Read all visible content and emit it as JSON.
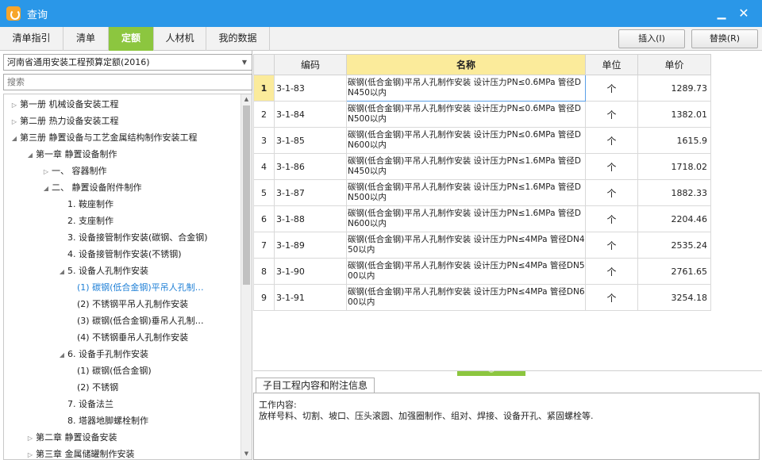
{
  "window": {
    "title": "查询",
    "minimize": "▁",
    "close": "✕"
  },
  "tabs": [
    {
      "label": "清单指引"
    },
    {
      "label": "清单"
    },
    {
      "label": "定额"
    },
    {
      "label": "人材机"
    },
    {
      "label": "我的数据"
    }
  ],
  "toolbar": {
    "insert_label": "插入(I)",
    "replace_label": "替换(R)"
  },
  "left_panel": {
    "quota_library": "河南省通用安装工程预算定额(2016)",
    "search_placeholder": "搜索",
    "tree": [
      {
        "label": "第一册 机械设备安装工程",
        "arrow": "▷"
      },
      {
        "label": "第二册 热力设备安装工程",
        "arrow": "▷"
      },
      {
        "label": "第三册 静置设备与工艺金属结构制作安装工程",
        "arrow": "◢"
      },
      {
        "label": "第一章 静置设备制作",
        "arrow": "◢"
      },
      {
        "label": "一、 容器制作",
        "arrow": "▷"
      },
      {
        "label": "二、 静置设备附件制作",
        "arrow": "◢"
      },
      {
        "label": "1. 鞍座制作",
        "arrow": ""
      },
      {
        "label": "2. 支座制作",
        "arrow": ""
      },
      {
        "label": "3. 设备接管制作安装(碳钢、合金钢)",
        "arrow": ""
      },
      {
        "label": "4. 设备接管制作安装(不锈钢)",
        "arrow": ""
      },
      {
        "label": "5. 设备人孔制作安装",
        "arrow": "◢"
      },
      {
        "label": "(1) 碳钢(低合金钢)平吊人孔制…",
        "arrow": ""
      },
      {
        "label": "(2) 不锈钢平吊人孔制作安装",
        "arrow": ""
      },
      {
        "label": "(3) 碳钢(低合金钢)垂吊人孔制…",
        "arrow": ""
      },
      {
        "label": "(4) 不锈钢垂吊人孔制作安装",
        "arrow": ""
      },
      {
        "label": "6. 设备手孔制作安装",
        "arrow": "◢"
      },
      {
        "label": "(1) 碳钢(低合金钢)",
        "arrow": ""
      },
      {
        "label": "(2) 不锈钢",
        "arrow": ""
      },
      {
        "label": "7. 设备法兰",
        "arrow": ""
      },
      {
        "label": "8. 塔器地脚螺栓制作",
        "arrow": ""
      },
      {
        "label": "第二章 静置设备安装",
        "arrow": "▷"
      },
      {
        "label": "第三章 金属储罐制作安装",
        "arrow": "▷"
      }
    ]
  },
  "grid": {
    "columns": [
      "编码",
      "名称",
      "单位",
      "单价"
    ],
    "rows": [
      {
        "no": "1",
        "code": "3-1-83",
        "name": "碳钢(低合金钢)平吊人孔制作安装 设计压力PN≤0.6MPa 管径DN450以内",
        "unit": "个",
        "price": "1289.73"
      },
      {
        "no": "2",
        "code": "3-1-84",
        "name": "碳钢(低合金钢)平吊人孔制作安装 设计压力PN≤0.6MPa 管径DN500以内",
        "unit": "个",
        "price": "1382.01"
      },
      {
        "no": "3",
        "code": "3-1-85",
        "name": "碳钢(低合金钢)平吊人孔制作安装 设计压力PN≤0.6MPa 管径DN600以内",
        "unit": "个",
        "price": "1615.9"
      },
      {
        "no": "4",
        "code": "3-1-86",
        "name": "碳钢(低合金钢)平吊人孔制作安装 设计压力PN≤1.6MPa 管径DN450以内",
        "unit": "个",
        "price": "1718.02"
      },
      {
        "no": "5",
        "code": "3-1-87",
        "name": "碳钢(低合金钢)平吊人孔制作安装 设计压力PN≤1.6MPa 管径DN500以内",
        "unit": "个",
        "price": "1882.33"
      },
      {
        "no": "6",
        "code": "3-1-88",
        "name": "碳钢(低合金钢)平吊人孔制作安装 设计压力PN≤1.6MPa 管径DN600以内",
        "unit": "个",
        "price": "2204.46"
      },
      {
        "no": "7",
        "code": "3-1-89",
        "name": "碳钢(低合金钢)平吊人孔制作安装 设计压力PN≤4MPa 管径DN450以内",
        "unit": "个",
        "price": "2535.24"
      },
      {
        "no": "8",
        "code": "3-1-90",
        "name": "碳钢(低合金钢)平吊人孔制作安装 设计压力PN≤4MPa 管径DN500以内",
        "unit": "个",
        "price": "2761.65"
      },
      {
        "no": "9",
        "code": "3-1-91",
        "name": "碳钢(低合金钢)平吊人孔制作安装 设计压力PN≤4MPa 管径DN600以内",
        "unit": "个",
        "price": "3254.18"
      }
    ]
  },
  "info_panel": {
    "tab_label": "子目工程内容和附注信息",
    "heading": "工作内容:",
    "content": "放样号料、切割、坡口、压头滚圆、加强圈制作、组对、焊接、设备开孔、紧固螺栓等."
  },
  "colors": {
    "titlebar": "#2a97e8",
    "active_tab": "#8cc63f",
    "header_highlight": "#fbeb9b",
    "tree_selected": "#1e7fd6"
  }
}
